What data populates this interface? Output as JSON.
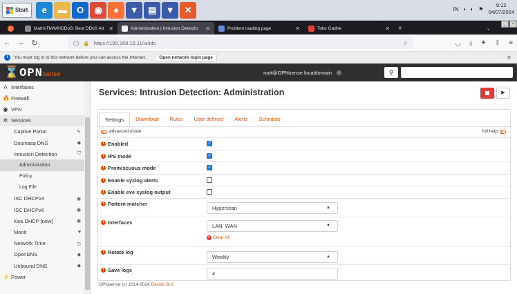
{
  "taskbar": {
    "start_label": "Start",
    "apps": [
      {
        "name": "internet-explorer-icon",
        "color": "#1e88d6",
        "glyph": "e"
      },
      {
        "name": "folder-icon",
        "color": "#e8b84a",
        "glyph": "▬"
      },
      {
        "name": "outlook-icon",
        "color": "#1267c9",
        "glyph": "O"
      },
      {
        "name": "chrome-icon",
        "color": "#dd4b39",
        "glyph": "◉"
      },
      {
        "name": "firefox-icon",
        "color": "#ff7139",
        "glyph": "●"
      },
      {
        "name": "opnsense-taskbar-icon",
        "color": "#3a5ba8",
        "glyph": "▼"
      },
      {
        "name": "notepad-icon",
        "color": "#3a5ba8",
        "glyph": "▤"
      },
      {
        "name": "opnsense-taskbar-icon-2",
        "color": "#3a5ba8",
        "glyph": "▼"
      },
      {
        "name": "xampp-icon",
        "color": "#e85a2c",
        "glyph": "✕"
      }
    ],
    "tray_lang": "IN",
    "clock_time": "9:12",
    "clock_date": "04/07/2024"
  },
  "browser": {
    "tabs": [
      {
        "title": "MatrixTM/MHDDoS: Best DDoS Att",
        "icon_color": "#8a8a8a",
        "active": false
      },
      {
        "title": "Administration | Intrusion Detectio",
        "icon_color": "#f0f0f0",
        "active": true
      },
      {
        "title": "Problem loading page",
        "icon_color": "#6a8ad8",
        "active": false
      },
      {
        "title": "Toko Gadhe",
        "icon_color": "#e04040",
        "active": false
      }
    ],
    "url_host": "https://192.168.15.11",
    "url_path": "/ui/ids",
    "infobar_text": "You must log in to this network before you can access the Internet.",
    "infobar_button": "Open network login page"
  },
  "header": {
    "logo_main": "OPN",
    "logo_suffix": "sense",
    "user": "root@OPNsense.localdomain"
  },
  "sidebar": {
    "items": [
      {
        "label": "Interfaces",
        "icon": "interfaces-icon",
        "glyph": "⛼",
        "level": "top"
      },
      {
        "label": "Firewall",
        "icon": "firewall-icon",
        "glyph": "🔥",
        "level": "top"
      },
      {
        "label": "VPN",
        "icon": "vpn-icon",
        "glyph": "◉",
        "level": "top"
      },
      {
        "label": "Services",
        "icon": "services-icon",
        "glyph": "✲",
        "level": "section"
      },
      {
        "label": "Captive Portal",
        "icon": "captive-portal-icon",
        "glyph": "✎",
        "level": "sub"
      },
      {
        "label": "Dnsmasq DNS",
        "icon": "dnsmasq-icon",
        "glyph": "◆",
        "level": "sub"
      },
      {
        "label": "Intrusion Detection",
        "icon": "shield-icon",
        "glyph": "⛉",
        "level": "sub"
      },
      {
        "label": "Administration",
        "icon": "",
        "glyph": "",
        "level": "subsub-current"
      },
      {
        "label": "Policy",
        "icon": "",
        "glyph": "",
        "level": "subsub"
      },
      {
        "label": "Log File",
        "icon": "",
        "glyph": "",
        "level": "subsub"
      },
      {
        "label": "ISC DHCPv4",
        "icon": "dhcpv4-icon",
        "glyph": "◉",
        "level": "sub"
      },
      {
        "label": "ISC DHCPv6",
        "icon": "dhcpv6-icon",
        "glyph": "◉",
        "level": "sub"
      },
      {
        "label": "Kea DHCP [new]",
        "icon": "kea-dhcp-icon",
        "glyph": "◉",
        "level": "sub"
      },
      {
        "label": "Monit",
        "icon": "monit-heart-icon",
        "glyph": "♥",
        "level": "sub"
      },
      {
        "label": "Network Time",
        "icon": "clock-icon",
        "glyph": "◷",
        "level": "sub"
      },
      {
        "label": "OpenDNS",
        "icon": "opendns-icon",
        "glyph": "◆",
        "level": "sub"
      },
      {
        "label": "Unbound DNS",
        "icon": "unbound-icon",
        "glyph": "◆",
        "level": "sub"
      },
      {
        "label": "Power",
        "icon": "power-icon",
        "glyph": "⚡",
        "level": "top"
      }
    ]
  },
  "main": {
    "title": "Services: Intrusion Detection: Administration",
    "tabs": [
      "Settings",
      "Download",
      "Rules",
      "User defined",
      "Alerts",
      "Schedule"
    ],
    "advanced_mode": "advanced mode",
    "full_help": "full help",
    "checkbox_rows": [
      {
        "label": "Enabled",
        "checked": true
      },
      {
        "label": "IPS mode",
        "checked": true
      },
      {
        "label": "Promiscuous mode",
        "checked": true
      },
      {
        "label": "Enable syslog alerts",
        "checked": false
      },
      {
        "label": "Enable eve syslog output",
        "checked": false
      }
    ],
    "pattern_matcher": {
      "label": "Pattern matcher",
      "value": "Hyperscan"
    },
    "interfaces": {
      "label": "Interfaces",
      "value": "LAN, WAN",
      "clear": "Clear All"
    },
    "rotate_log": {
      "label": "Rotate log",
      "value": "Weekly"
    },
    "save_logs": {
      "label": "Save logs",
      "value": "4"
    },
    "footer_prefix": "OPNsense (c) 2014-2024 ",
    "footer_link": "Deciso B.V."
  },
  "colors": {
    "accent": "#d94f00",
    "header_bg": "#2f2f2f",
    "stop_red": "#e03b3b",
    "checkbox_blue": "#2c6fd6"
  }
}
